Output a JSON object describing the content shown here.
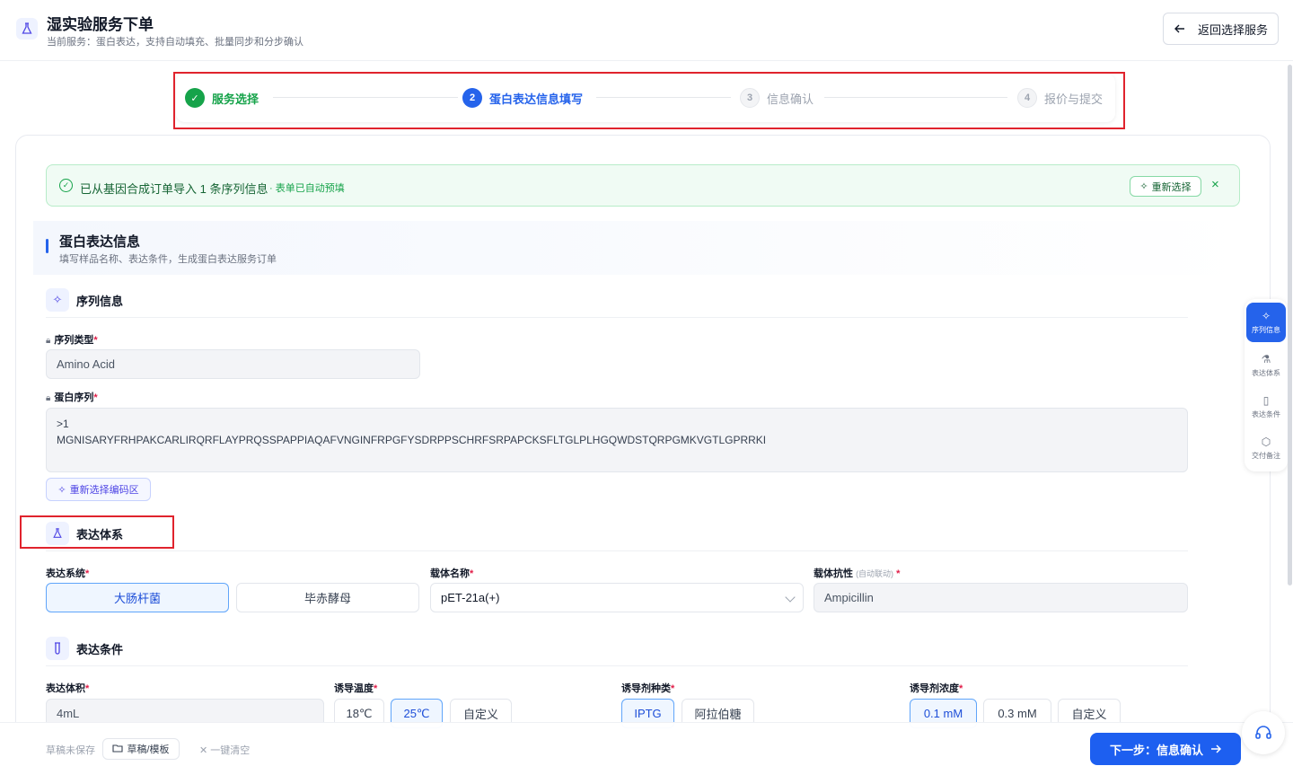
{
  "header": {
    "title": "湿实验服务下单",
    "subtitle": "当前服务：蛋白表达，支持自动填充、批量同步和分步确认",
    "back_label": "返回选择服务"
  },
  "stepper": {
    "steps": [
      {
        "num": "✓",
        "label": "服务选择",
        "state": "done"
      },
      {
        "num": "2",
        "label": "蛋白表达信息填写",
        "state": "active"
      },
      {
        "num": "3",
        "label": "信息确认",
        "state": "todo"
      },
      {
        "num": "4",
        "label": "报价与提交",
        "state": "todo"
      }
    ]
  },
  "notice": {
    "text": "已从基因合成订单导入 1 条序列信息",
    "sub": "· 表单已自动预填",
    "reselect_label": "重新选择",
    "close_glyph": "×"
  },
  "section": {
    "title": "蛋白表达信息",
    "desc": "填写样品名称、表达条件，生成蛋白表达服务订单"
  },
  "sequence_group": {
    "title": "序列信息",
    "seq_type_label": "序列类型",
    "seq_type_value": "Amino Acid",
    "protein_seq_label": "蛋白序列",
    "protein_seq_value": ">1\nMGNISARYFRHPAKCARLIRQRFLAYPRQSSPAPPIAQAFVNGINFRPGFYSDRPPSCHRFSRPAPCKSFLTGLPLHGQWDSTQRPGMKVGTLGPRRKI",
    "reselect_region_label": "重新选择编码区"
  },
  "expression_system_group": {
    "title": "表达体系",
    "system_label": "表达系统",
    "system_options": [
      "大肠杆菌",
      "毕赤酵母"
    ],
    "vector_label": "载体名称",
    "vector_value": "pET-21a(+)",
    "resistance_label": "载体抗性",
    "resistance_hint": "(自动联动)",
    "resistance_value": "Ampicillin"
  },
  "expression_conditions_group": {
    "title": "表达条件",
    "volume_label": "表达体积",
    "volume_value": "4mL",
    "temp_label": "诱导温度",
    "temp_options": [
      "18℃",
      "25℃",
      "自定义"
    ],
    "inducer_label": "诱导剂种类",
    "inducer_options": [
      "IPTG",
      "阿拉伯糖"
    ],
    "conc_label": "诱导剂浓度",
    "conc_options": [
      "0.1 mM",
      "0.3 mM",
      "自定义"
    ]
  },
  "anchor_nav": {
    "items": [
      "序列信息",
      "表达体系",
      "表达条件",
      "交付备注"
    ]
  },
  "footer": {
    "draft_status": "草稿未保存",
    "draft_label": "草稿/模板",
    "clear_label": "一键清空",
    "next_label": "下一步：信息确认"
  },
  "required_mark": "*",
  "colors": {
    "primary": "#2563eb",
    "success": "#16a34a",
    "annotation_red": "#e0232d"
  }
}
